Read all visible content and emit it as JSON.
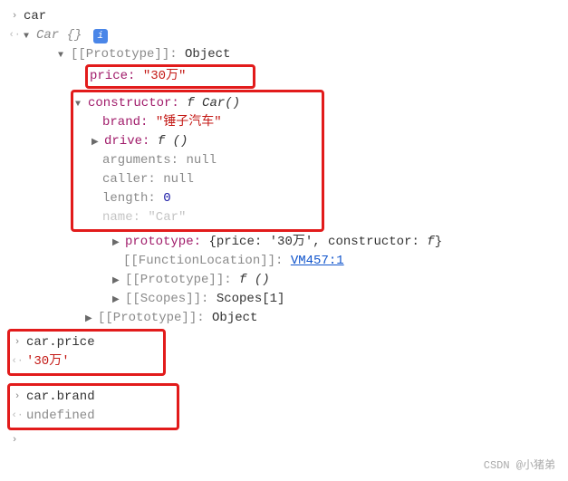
{
  "lines": {
    "l1": "car",
    "l2_prefix": "Car",
    "l2_braces": "{}",
    "l3_key": "[[Prototype]]",
    "l3_val": "Object",
    "l4_key": "price",
    "l4_val": "\"30万\"",
    "l5_key": "constructor",
    "l5_val_f": "f",
    "l5_val_rest": " Car()",
    "l6_key": "brand",
    "l6_val": "\"锤子汽车\"",
    "l7_key": "drive",
    "l7_val_f": "f",
    "l7_val_rest": " ()",
    "l8_key": "arguments",
    "l8_val": "null",
    "l9_key": "caller",
    "l9_val": "null",
    "l10_key": "length",
    "l10_val": "0",
    "l11_truncated": "name: \"Car\"",
    "l12_key": "prototype",
    "l12_val": "{price: '30万', constructor: ",
    "l12_f": "f",
    "l12_close": "}",
    "l13_key": "[[FunctionLocation]]",
    "l13_link": "VM457:1",
    "l14_key": "[[Prototype]]",
    "l14_val_f": "f",
    "l14_val_rest": " ()",
    "l15_key": "[[Scopes]]",
    "l15_val": "Scopes[1]",
    "l16_key": "[[Prototype]]",
    "l16_val": "Object",
    "l17": "car.price",
    "l18": "'30万'",
    "l19": "car.brand",
    "l20": "undefined",
    "footer": "CSDN @小猪弟"
  }
}
